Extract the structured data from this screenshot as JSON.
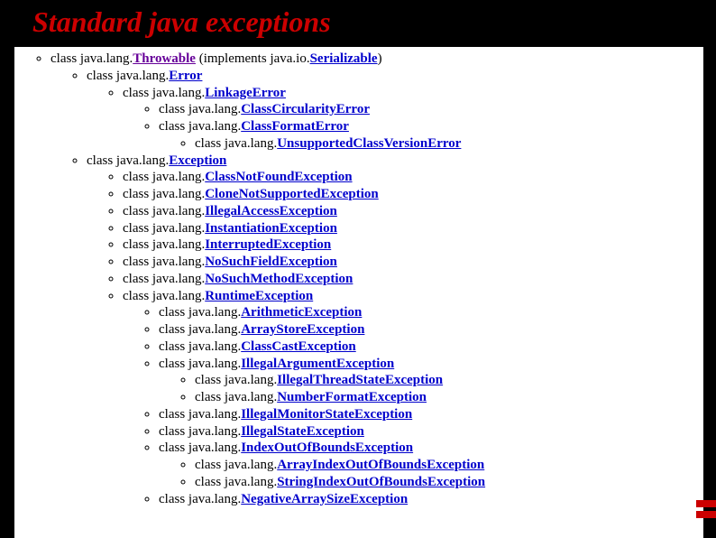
{
  "title": "Standard java exceptions",
  "prefix": "class java.lang.",
  "impl_open": " (implements java.io.",
  "impl_link": "Serializable",
  "impl_close": ")",
  "c": {
    "throwable": "Throwable",
    "error": "Error",
    "linkage": "LinkageError",
    "circ": "ClassCircularityError",
    "format": "ClassFormatError",
    "unsup": "UnsupportedClassVersionError",
    "exception": "Exception",
    "cnf": "ClassNotFoundException",
    "clone": "CloneNotSupportedException",
    "illaccess": "IllegalAccessException",
    "instant": "InstantiationException",
    "interrupt": "InterruptedException",
    "nsf": "NoSuchFieldException",
    "nsm": "NoSuchMethodException",
    "runtime": "RuntimeException",
    "arith": "ArithmeticException",
    "astore": "ArrayStoreException",
    "ccast": "ClassCastException",
    "illarg": "IllegalArgumentException",
    "ithread": "IllegalThreadStateException",
    "nformat": "NumberFormatException",
    "illmon": "IllegalMonitorStateException",
    "illstate": "IllegalStateException",
    "ioob": "IndexOutOfBoundsException",
    "aioob": "ArrayIndexOutOfBoundsException",
    "sioob": "StringIndexOutOfBoundsException",
    "negarr": "NegativeArraySizeException"
  }
}
